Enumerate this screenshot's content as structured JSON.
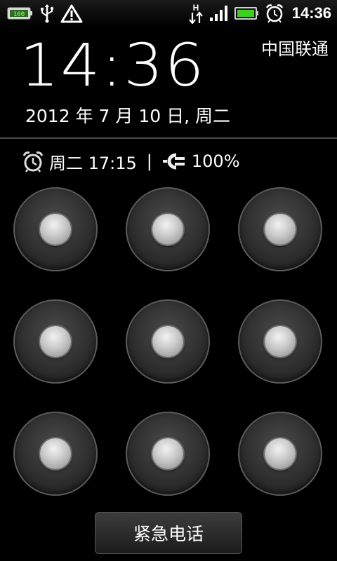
{
  "status_bar": {
    "left_icons": [
      "battery-charging-icon",
      "usb-icon",
      "warning-icon"
    ],
    "right_icons": [
      "hspa-data-icon",
      "signal-strength-icon",
      "battery-full-icon",
      "alarm-clock-icon"
    ],
    "time": "14:36",
    "battery_color": "#39d21c"
  },
  "lockscreen": {
    "clock": "14:36",
    "carrier": "中国联通",
    "date": "2012 年 7 月 10 日, 周二",
    "alarm": "周二 17:15",
    "separator": "|",
    "battery_percent": "100%"
  },
  "pattern": {
    "rows": 3,
    "cols": 3
  },
  "emergency_button": {
    "label": "紧急电话"
  }
}
